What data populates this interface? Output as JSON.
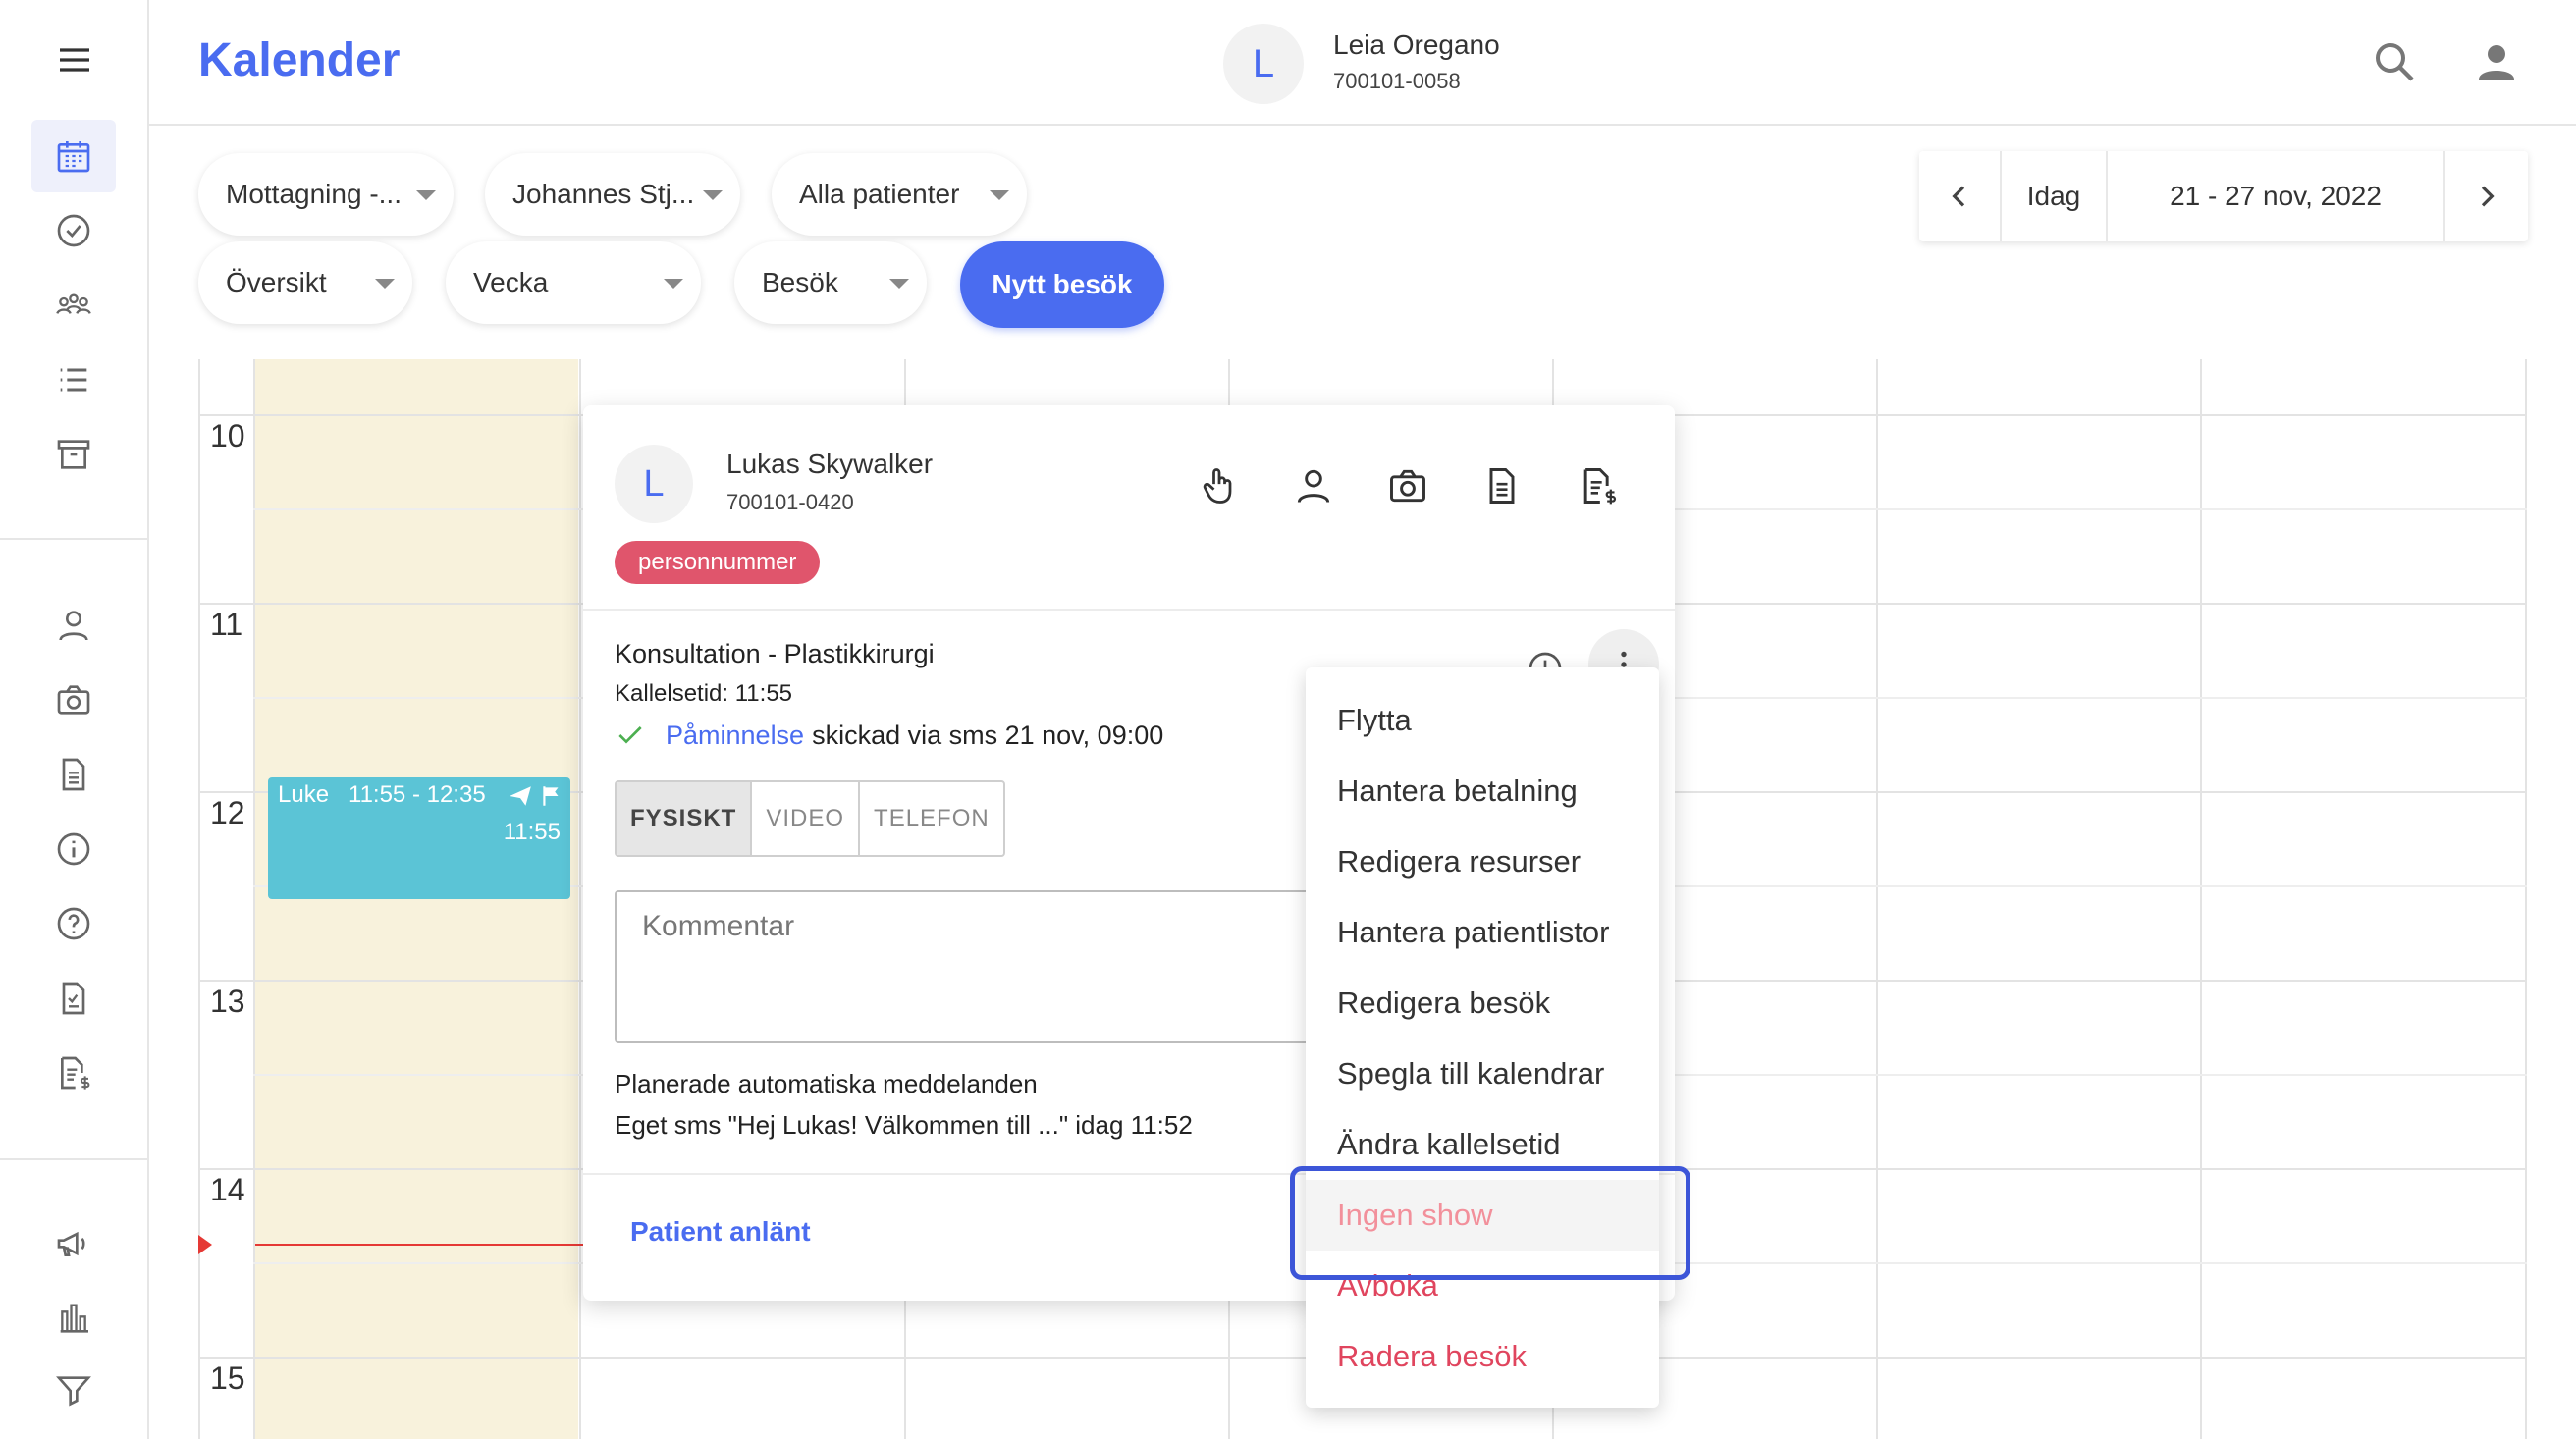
{
  "app": {
    "title": "Kalender"
  },
  "header": {
    "patient_initial": "L",
    "patient_name": "Leia Oregano",
    "patient_id": "700101-0058"
  },
  "sidebar": {
    "groups": [
      [
        "calendar-icon",
        "check-circle-icon",
        "group-icon",
        "list-icon",
        "archive-icon"
      ],
      [
        "person-icon",
        "camera-icon",
        "document-icon",
        "info-icon",
        "help-icon",
        "report-icon",
        "invoice-icon"
      ],
      [
        "megaphone-icon",
        "bar-chart-icon",
        "filter-icon"
      ]
    ]
  },
  "filters": {
    "clinic": "Mottagning -...",
    "practitioner": "Johannes Stj...",
    "patients": "Alla patienter",
    "view": "Översikt",
    "period": "Vecka",
    "type": "Besök",
    "new_visit": "Nytt besök"
  },
  "datenav": {
    "today": "Idag",
    "range": "21 - 27 nov, 2022"
  },
  "calendar": {
    "hours": [
      "10",
      "11",
      "12",
      "13",
      "14",
      "15"
    ],
    "event": {
      "name": "Luke",
      "time": "11:55 - 12:35",
      "call_time": "11:55",
      "color": "#5bc4d6"
    },
    "now_color": "#e53935"
  },
  "card": {
    "initial": "L",
    "name": "Lukas Skywalker",
    "id": "700101-0420",
    "badge": "personnummer",
    "visit_type": "Konsultation - Plastikkirurgi",
    "call_time": "Kallelsetid: 11:55",
    "reminder_link": "Påminnelse",
    "reminder_text": "skickad via sms 21 nov, 09:00",
    "modes": [
      "FYSISKT",
      "VIDEO",
      "TELEFON"
    ],
    "selected_mode": "FYSISKT",
    "comment_placeholder": "Kommentar",
    "auto_title": "Planerade automatiska meddelanden",
    "auto_msg": "Eget sms \"Hej Lukas! Välkommen till ...\" idag 11:52",
    "arrived": "Patient anlänt"
  },
  "menu": {
    "items": [
      {
        "label": "Flytta",
        "style": "normal"
      },
      {
        "label": "Hantera betalning",
        "style": "normal"
      },
      {
        "label": "Redigera resurser",
        "style": "normal"
      },
      {
        "label": "Hantera patientlistor",
        "style": "normal"
      },
      {
        "label": "Redigera besök",
        "style": "normal"
      },
      {
        "label": "Spegla till kalendrar",
        "style": "normal"
      },
      {
        "label": "Ändra kallelsetid",
        "style": "normal"
      },
      {
        "label": "Ingen show",
        "style": "hover"
      },
      {
        "label": "Avboka",
        "style": "danger"
      },
      {
        "label": "Radera besök",
        "style": "danger"
      }
    ]
  },
  "colors": {
    "accent": "#4a6cf0",
    "danger": "#e0455e",
    "badge": "#e0556c",
    "today_column": "#f8f2dc",
    "highlight": "#3d56d8"
  }
}
